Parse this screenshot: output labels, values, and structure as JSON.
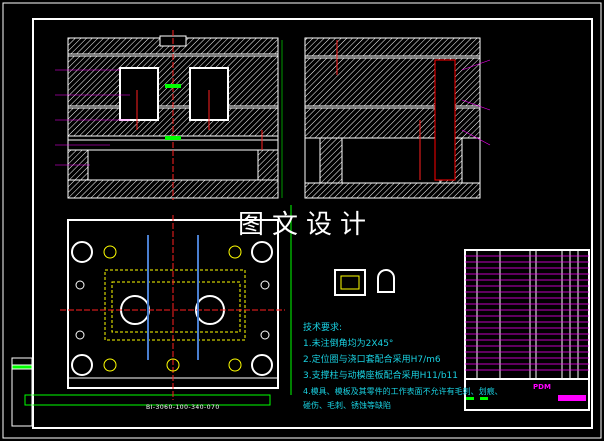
{
  "watermark": "图文设计",
  "tech_requirements": {
    "title": "技术要求:",
    "items": [
      "1.未注倒角均为2X45°",
      "2.定位圈与浇口套配合采用H7/m6",
      "3.支撑柱与动模座板配合采用H11/b11",
      "4.模具、模板及其零件的工作表面不允许有毛刺、划痕、",
      "碰伤、毛刺、锈蚀等缺陷"
    ]
  },
  "plan_view_label": "BI-3060-100-340-070",
  "title_block_label": "PDM",
  "colors": {
    "frame": "#ffffff",
    "hatch": "#ffffff",
    "centerline": "#ff2020",
    "leader": "#ff00ff",
    "dim": "#00ff00",
    "text": "#19d0e0",
    "yellow": "#ffff00"
  }
}
